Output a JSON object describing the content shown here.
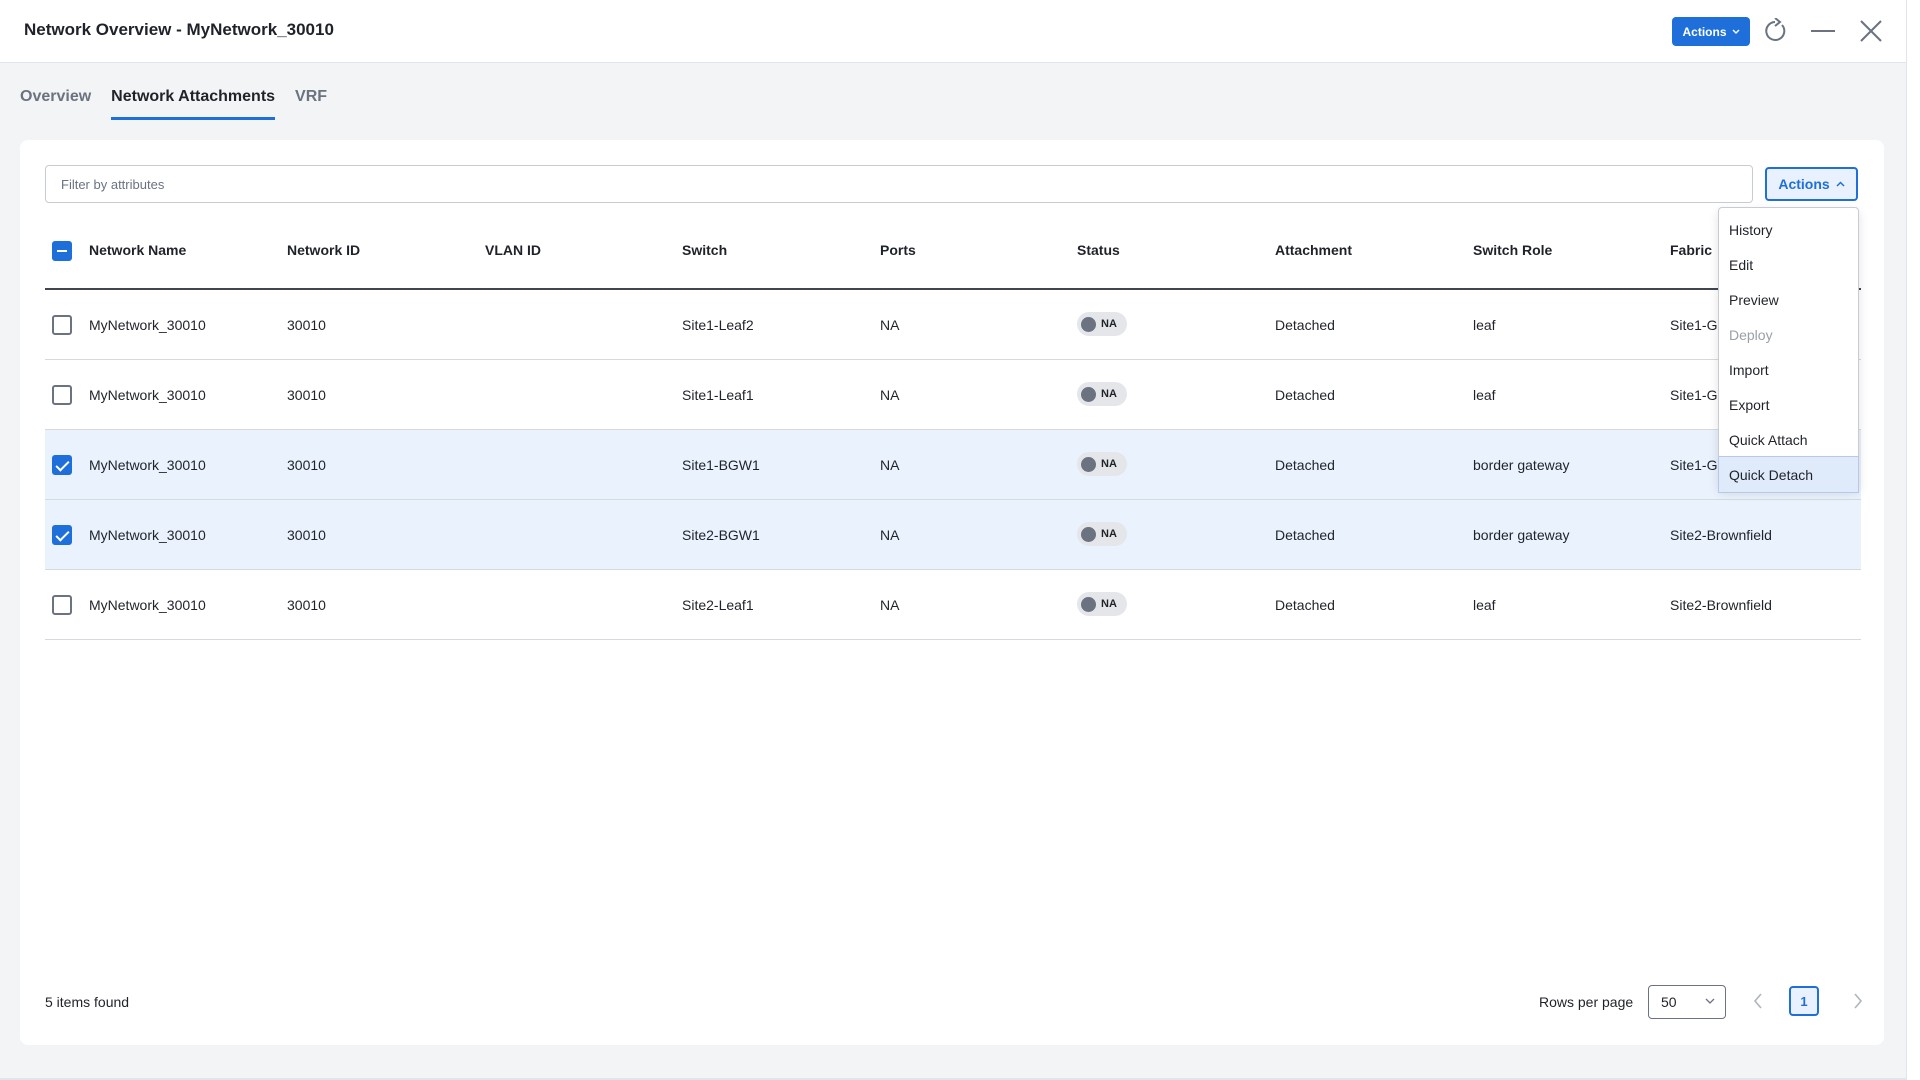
{
  "header": {
    "title": "Network Overview - MyNetwork_30010",
    "actions_label": "Actions"
  },
  "tabs": [
    {
      "label": "Overview",
      "active": false
    },
    {
      "label": "Network Attachments",
      "active": true
    },
    {
      "label": "VRF",
      "active": false
    }
  ],
  "filter": {
    "placeholder": "Filter by attributes",
    "value": ""
  },
  "card_actions_label": "Actions",
  "columns": [
    "Network Name",
    "Network ID",
    "VLAN ID",
    "Switch",
    "Ports",
    "Status",
    "Attachment",
    "Switch Role",
    "Fabric"
  ],
  "rows": [
    {
      "selected": false,
      "network_name": "MyNetwork_30010",
      "network_id": "30010",
      "vlan_id": "",
      "switch": "Site1-Leaf2",
      "ports": "NA",
      "status": "NA",
      "attachment": "Detached",
      "switch_role": "leaf",
      "fabric": "Site1-G"
    },
    {
      "selected": false,
      "network_name": "MyNetwork_30010",
      "network_id": "30010",
      "vlan_id": "",
      "switch": "Site1-Leaf1",
      "ports": "NA",
      "status": "NA",
      "attachment": "Detached",
      "switch_role": "leaf",
      "fabric": "Site1-G"
    },
    {
      "selected": true,
      "network_name": "MyNetwork_30010",
      "network_id": "30010",
      "vlan_id": "",
      "switch": "Site1-BGW1",
      "ports": "NA",
      "status": "NA",
      "attachment": "Detached",
      "switch_role": "border gateway",
      "fabric": "Site1-G"
    },
    {
      "selected": true,
      "network_name": "MyNetwork_30010",
      "network_id": "30010",
      "vlan_id": "",
      "switch": "Site2-BGW1",
      "ports": "NA",
      "status": "NA",
      "attachment": "Detached",
      "switch_role": "border gateway",
      "fabric": "Site2-Brownfield"
    },
    {
      "selected": false,
      "network_name": "MyNetwork_30010",
      "network_id": "30010",
      "vlan_id": "",
      "switch": "Site2-Leaf1",
      "ports": "NA",
      "status": "NA",
      "attachment": "Detached",
      "switch_role": "leaf",
      "fabric": "Site2-Brownfield"
    }
  ],
  "dropdown": [
    {
      "label": "History",
      "disabled": false,
      "hover": false
    },
    {
      "label": "Edit",
      "disabled": false,
      "hover": false
    },
    {
      "label": "Preview",
      "disabled": false,
      "hover": false
    },
    {
      "label": "Deploy",
      "disabled": true,
      "hover": false
    },
    {
      "label": "Import",
      "disabled": false,
      "hover": false
    },
    {
      "label": "Export",
      "disabled": false,
      "hover": false
    },
    {
      "label": "Quick Attach",
      "disabled": false,
      "hover": false
    },
    {
      "label": "Quick Detach",
      "disabled": false,
      "hover": true
    }
  ],
  "footer": {
    "count_text": "5 items found",
    "rows_per_page_label": "Rows per page",
    "rows_per_page_value": "50",
    "current_page": "1"
  },
  "colors": {
    "accent": "#1e6fd9",
    "selected_row": "#eaf2fd",
    "status_dot": "#6b7280"
  },
  "icons": [
    "chevron-down-icon",
    "refresh-icon",
    "minimize-icon",
    "close-icon",
    "chevron-up-icon",
    "chevron-left-icon",
    "chevron-right-icon",
    "checkbox-icon"
  ]
}
